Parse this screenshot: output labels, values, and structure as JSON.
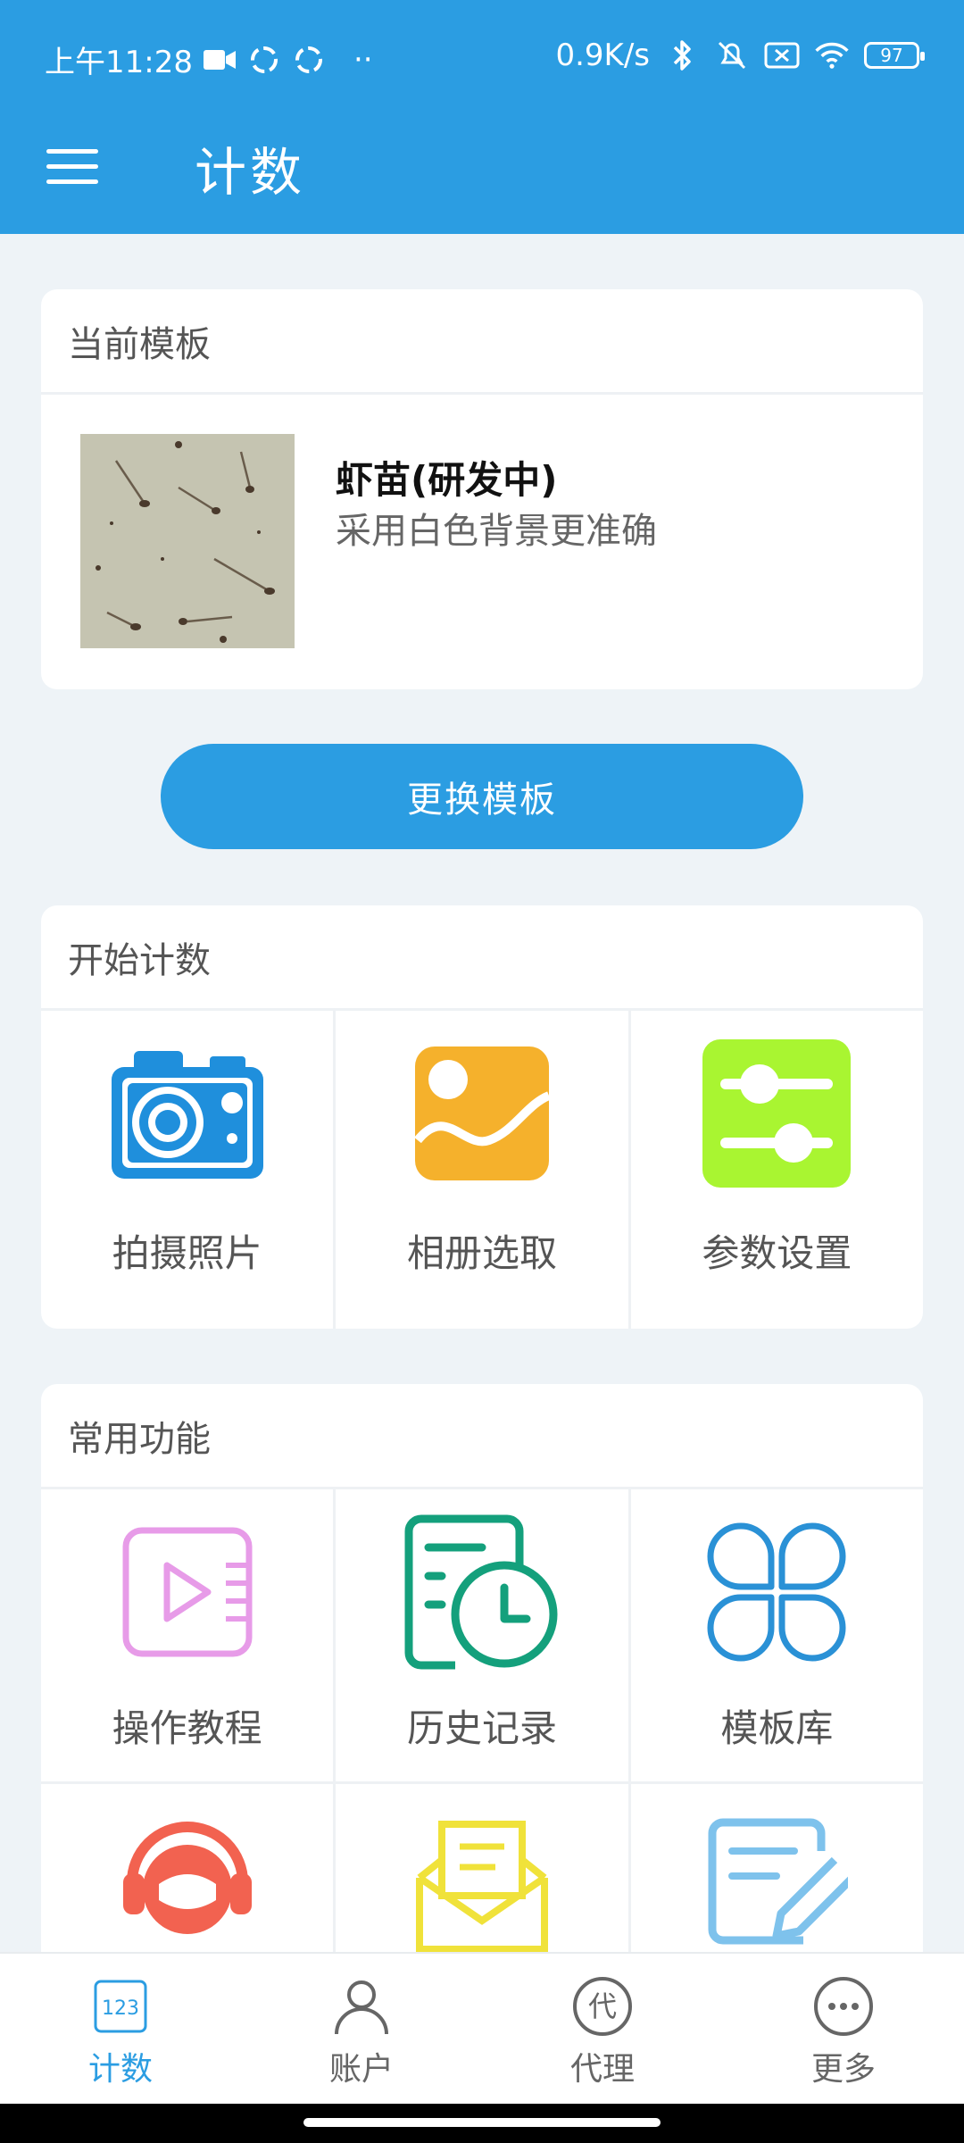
{
  "status": {
    "time": "上午11:28",
    "dots": "··",
    "net_speed": "0.9K/s",
    "battery": "97"
  },
  "appbar": {
    "title": "计数"
  },
  "template_card": {
    "header": "当前模板",
    "name": "虾苗(研发中)",
    "description": "采用白色背景更准确"
  },
  "change_button": "更换模板",
  "start_card": {
    "header": "开始计数",
    "items": [
      {
        "label": "拍摄照片",
        "icon": "camera-icon"
      },
      {
        "label": "相册选取",
        "icon": "gallery-icon"
      },
      {
        "label": "参数设置",
        "icon": "sliders-icon"
      }
    ]
  },
  "func_card": {
    "header": "常用功能",
    "items": [
      {
        "label": "操作教程",
        "icon": "video-tutorial-icon"
      },
      {
        "label": "历史记录",
        "icon": "history-icon"
      },
      {
        "label": "模板库",
        "icon": "template-library-icon"
      },
      {
        "label": "",
        "icon": "customer-service-icon"
      },
      {
        "label": "",
        "icon": "mail-icon"
      },
      {
        "label": "",
        "icon": "edit-note-icon"
      }
    ]
  },
  "bottom_nav": {
    "items": [
      {
        "label": "计数",
        "icon_text": "123",
        "active": true
      },
      {
        "label": "账户"
      },
      {
        "label": "代理",
        "icon_text": "代"
      },
      {
        "label": "更多"
      }
    ]
  },
  "colors": {
    "primary": "#2b9de2",
    "camera": "#1f8fdc",
    "gallery": "#f5b12c",
    "sliders": "#a9f531",
    "tutorial": "#e79be8",
    "history": "#14a07c",
    "library": "#2a91d6",
    "service": "#f26250",
    "mail": "#f0e23a",
    "note": "#7ec2ec"
  }
}
